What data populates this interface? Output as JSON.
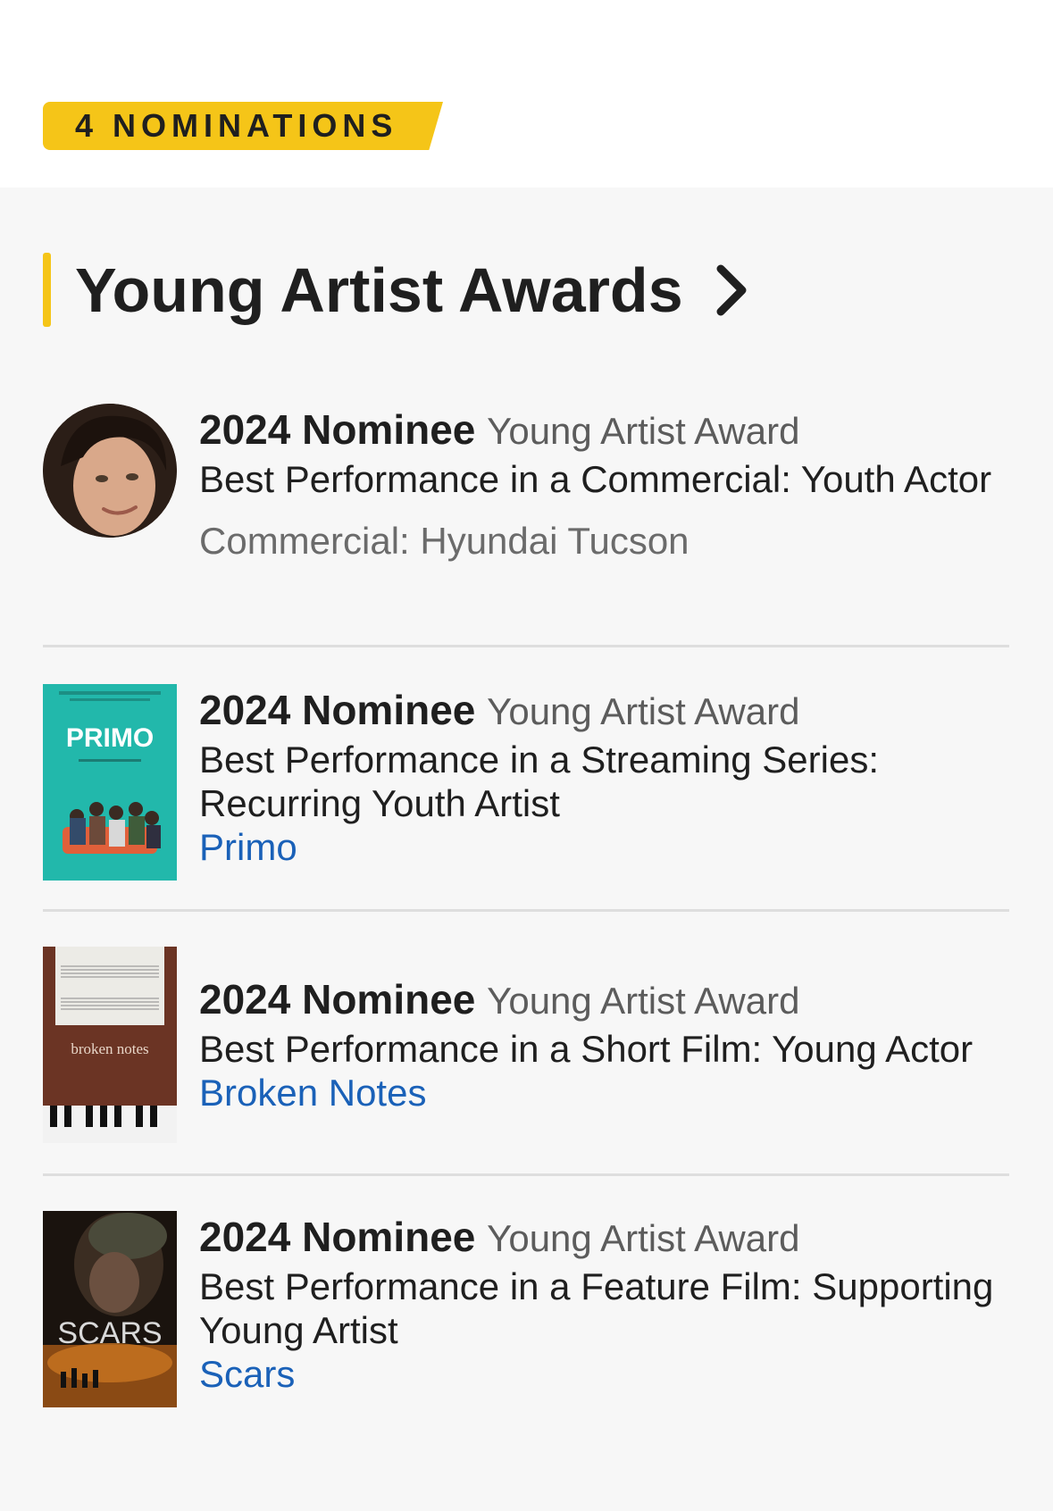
{
  "badge": {
    "label": "4 NOMINATIONS"
  },
  "section": {
    "title": "Young Artist Awards"
  },
  "items": [
    {
      "year_status": "2024 Nominee",
      "award": "Young Artist Award",
      "category": "Best Performance in a Commercial: Youth Actor",
      "detail": "Commercial: Hyundai Tucson",
      "work": ""
    },
    {
      "year_status": "2024 Nominee",
      "award": "Young Artist Award",
      "category": "Best Performance in a Streaming Series: Recurring Youth Artist",
      "work": "Primo",
      "poster_title": "PRIMO"
    },
    {
      "year_status": "2024 Nominee",
      "award": "Young Artist Award",
      "category": "Best Performance in a Short Film: Young Actor",
      "work": "Broken Notes",
      "poster_title": "broken notes"
    },
    {
      "year_status": "2024 Nominee",
      "award": "Young Artist Award",
      "category": "Best Performance in a Feature Film: Supporting Young Artist",
      "work": "Scars",
      "poster_title": "SCARS"
    }
  ],
  "colors": {
    "accent": "#f5c518",
    "link": "#1a61b8",
    "background": "#f7f7f7"
  }
}
